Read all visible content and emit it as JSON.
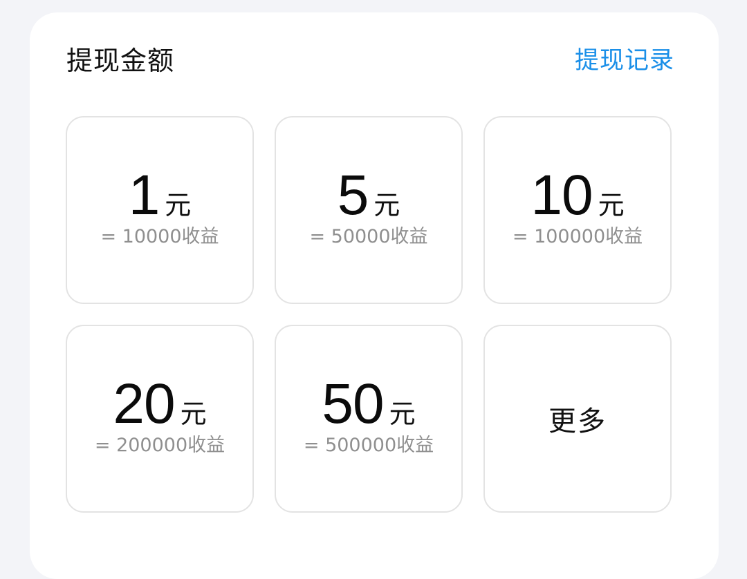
{
  "header": {
    "title": "提现金额",
    "record_link": "提现记录"
  },
  "options": [
    {
      "amount": "1",
      "unit": "元",
      "equiv": "= 10000收益"
    },
    {
      "amount": "5",
      "unit": "元",
      "equiv": "= 50000收益"
    },
    {
      "amount": "10",
      "unit": "元",
      "equiv": "= 100000收益"
    },
    {
      "amount": "20",
      "unit": "元",
      "equiv": "= 200000收益"
    },
    {
      "amount": "50",
      "unit": "元",
      "equiv": "= 500000收益"
    }
  ],
  "more_label": "更多",
  "colors": {
    "link": "#1a8fe8",
    "background": "#f3f4f8",
    "card": "#ffffff",
    "tile_border": "#e3e3e3",
    "secondary_text": "#8f8f8f"
  }
}
